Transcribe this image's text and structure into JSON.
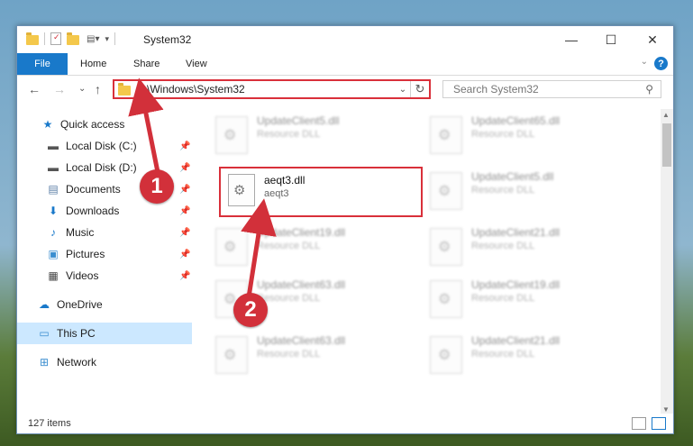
{
  "window": {
    "title": "System32"
  },
  "controls": {
    "minimize": "—",
    "maximize": "☐",
    "close": "✕"
  },
  "ribbon": {
    "tabs": [
      "File",
      "Home",
      "Share",
      "View"
    ],
    "help": "?"
  },
  "address": {
    "path": "C:\\Windows\\System32",
    "refresh": "↻"
  },
  "search": {
    "placeholder": "Search System32"
  },
  "nav": {
    "back": "←",
    "forward": "→",
    "recent": "⌄",
    "up": "↑"
  },
  "sidebar": {
    "items": [
      {
        "label": "Quick access",
        "icon": "star-icon"
      },
      {
        "label": "Local Disk (C:)",
        "icon": "drive-icon"
      },
      {
        "label": "Local Disk (D:)",
        "icon": "drive-icon"
      },
      {
        "label": "Documents",
        "icon": "documents-icon"
      },
      {
        "label": "Downloads",
        "icon": "downloads-icon"
      },
      {
        "label": "Music",
        "icon": "music-icon"
      },
      {
        "label": "Pictures",
        "icon": "pictures-icon"
      },
      {
        "label": "Videos",
        "icon": "videos-icon"
      },
      {
        "label": "OneDrive",
        "icon": "cloud-icon"
      },
      {
        "label": "This PC",
        "icon": "computer-icon"
      },
      {
        "label": "Network",
        "icon": "network-icon"
      }
    ]
  },
  "files": {
    "left": [
      {
        "name": "UpdateClient5.dll",
        "type": "Resource DLL"
      },
      {
        "name": "UpdateClient19.dll",
        "type": "Resource DLL"
      },
      {
        "name": "UpdateClient63.dll",
        "type": "Resource DLL"
      },
      {
        "name": "UpdateClient63.dll",
        "type": "Resource DLL"
      }
    ],
    "right": [
      {
        "name": "UpdateClient65.dll",
        "type": "Resource DLL"
      },
      {
        "name": "UpdateClient5.dll",
        "type": "Resource DLL"
      },
      {
        "name": "UpdateClient21.dll",
        "type": "Resource DLL"
      },
      {
        "name": "UpdateClient19.dll",
        "type": "Resource DLL"
      },
      {
        "name": "UpdateClient21.dll",
        "type": "Resource DLL"
      }
    ],
    "highlighted": {
      "name": "aeqt3.dll",
      "type": "aeqt3"
    }
  },
  "status": {
    "count": "127 items"
  },
  "annotations": {
    "step1": "1",
    "step2": "2",
    "color": "#d2303a"
  }
}
